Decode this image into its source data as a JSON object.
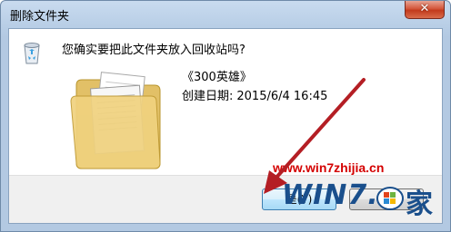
{
  "window": {
    "title": "删除文件夹",
    "close_glyph": "✕"
  },
  "dialog": {
    "question": "您确实要把此文件夹放入回收站吗?",
    "item_name": "《300英雄》",
    "date_label": "创建日期:",
    "date_value": "2015/6/4 16:45"
  },
  "buttons": {
    "yes_label": "是(Y)"
  },
  "watermark": {
    "url": "www.win7zhijia.cn",
    "logo_text": "WIN7.",
    "logo_char": "家",
    "color": "#d40000",
    "logo_color": "#1a4f8c"
  },
  "icons": {
    "recycle": "recycle-bin-icon",
    "folder": "folder-icon",
    "close": "close-icon",
    "arrow": "annotation-arrow"
  }
}
